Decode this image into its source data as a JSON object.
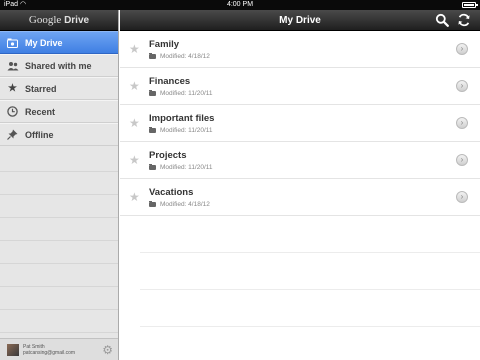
{
  "status_bar": {
    "carrier": "iPad",
    "time": "4:00 PM"
  },
  "sidebar": {
    "brand_google": "Google",
    "brand_drive": "Drive",
    "items": [
      {
        "label": "My Drive",
        "icon": "my-drive-icon",
        "active": true
      },
      {
        "label": "Shared with me",
        "icon": "people-icon",
        "active": false
      },
      {
        "label": "Starred",
        "icon": "star-icon",
        "active": false
      },
      {
        "label": "Recent",
        "icon": "clock-icon",
        "active": false
      },
      {
        "label": "Offline",
        "icon": "pin-icon",
        "active": false
      }
    ],
    "account": {
      "name": "Pat Smith",
      "email": "patcansing@gmail.com"
    }
  },
  "main": {
    "title": "My Drive",
    "files": [
      {
        "name": "Family",
        "modified": "Modified: 4/18/12"
      },
      {
        "name": "Finances",
        "modified": "Modified: 11/20/11"
      },
      {
        "name": "Important files",
        "modified": "Modified: 11/20/11"
      },
      {
        "name": "Projects",
        "modified": "Modified: 11/20/11"
      },
      {
        "name": "Vacations",
        "modified": "Modified: 4/18/12"
      }
    ]
  },
  "colors": {
    "accent": "#4a86e8",
    "topbar": "#2a2a2a",
    "sidebar_bg": "#e6e6e6"
  }
}
